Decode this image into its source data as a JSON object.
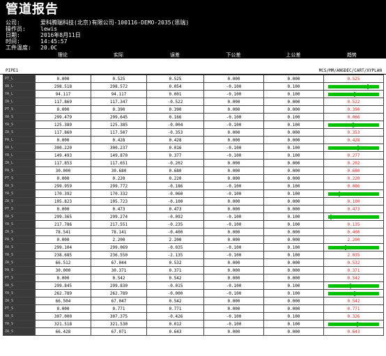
{
  "header": {
    "title": "管道报告"
  },
  "info": [
    {
      "key": "公司:",
      "value": "爱科腾瑞科技(北京)有限公司-100116-DEMO-2035(思瑞)"
    },
    {
      "key": "操作员:",
      "value": "lewis"
    },
    {
      "key": "日期:",
      "value": "2016年8月11日"
    },
    {
      "key": "时间:",
      "value": "14:45:57"
    },
    {
      "key": "工件温度:",
      "value": "20.0C"
    }
  ],
  "columns": [
    "",
    "理论",
    "实际",
    "误差",
    "下公差",
    "上公差",
    "趋势"
  ],
  "pipe": {
    "name": "PIPE1",
    "mode": "MCS/MM/ANGDEC/CART/XYPLAN"
  },
  "rows": [
    {
      "label": "PT_L",
      "nominal": "0.000",
      "actual": "0.525",
      "dev": "0.525",
      "lower": "0.000",
      "upper": "0.000",
      "trend": "0.525",
      "type": "red"
    },
    {
      "label": "XA_L",
      "nominal": "298.518",
      "actual": "298.572",
      "dev": "0.054",
      "lower": "-0.100",
      "upper": "0.100",
      "trend": "",
      "type": "bar"
    },
    {
      "label": "YA_L",
      "nominal": "94.117",
      "actual": "94.117",
      "dev": "0.001",
      "lower": "-0.100",
      "upper": "0.100",
      "trend": "",
      "type": "bar"
    },
    {
      "label": "ZA_L",
      "nominal": "117.869",
      "actual": "117.347",
      "dev": "-0.522",
      "lower": "0.000",
      "upper": "0.000",
      "trend": "0.522",
      "type": "red"
    },
    {
      "label": "PT_S",
      "nominal": "0.000",
      "actual": "0.390",
      "dev": "0.390",
      "lower": "0.000",
      "upper": "0.000",
      "trend": "0.390",
      "type": "red"
    },
    {
      "label": "XA_S",
      "nominal": "299.479",
      "actual": "299.645",
      "dev": "0.166",
      "lower": "-0.100",
      "upper": "0.100",
      "trend": "0.066",
      "type": "red"
    },
    {
      "label": "YA_S",
      "nominal": "125.389",
      "actual": "125.385",
      "dev": "-0.004",
      "lower": "-0.100",
      "upper": "0.100",
      "trend": "",
      "type": "bar"
    },
    {
      "label": "ZA_S",
      "nominal": "117.860",
      "actual": "117.507",
      "dev": "-0.353",
      "lower": "0.000",
      "upper": "0.000",
      "trend": "0.353",
      "type": "red"
    },
    {
      "label": "PA_L",
      "nominal": "0.000",
      "actual": "0.428",
      "dev": "0.428",
      "lower": "0.000",
      "upper": "0.000",
      "trend": "0.428",
      "type": "red"
    },
    {
      "label": "XA_L",
      "nominal": "300.220",
      "actual": "300.237",
      "dev": "0.016",
      "lower": "-0.100",
      "upper": "0.100",
      "trend": "",
      "type": "bar"
    },
    {
      "label": "YA_L",
      "nominal": "149.493",
      "actual": "149.870",
      "dev": "0.377",
      "lower": "-0.100",
      "upper": "0.100",
      "trend": "0.277",
      "type": "red"
    },
    {
      "label": "ZA_L",
      "nominal": "117.853",
      "actual": "117.651",
      "dev": "-0.202",
      "lower": "0.000",
      "upper": "0.000",
      "trend": "0.202",
      "type": "red"
    },
    {
      "label": "PA_S",
      "nominal": "30.000",
      "actual": "30.680",
      "dev": "0.680",
      "lower": "0.000",
      "upper": "0.000",
      "trend": "0.680",
      "type": "red"
    },
    {
      "label": "PT_S",
      "nominal": "0.000",
      "actual": "0.220",
      "dev": "0.220",
      "lower": "0.000",
      "upper": "0.000",
      "trend": "0.220",
      "type": "red"
    },
    {
      "label": "XA_S",
      "nominal": "299.959",
      "actual": "299.772",
      "dev": "-0.186",
      "lower": "-0.100",
      "upper": "0.100",
      "trend": "0.086",
      "type": "red"
    },
    {
      "label": "YA_S",
      "nominal": "170.392",
      "actual": "170.332",
      "dev": "-0.060",
      "lower": "-0.100",
      "upper": "0.100",
      "trend": "",
      "type": "bar"
    },
    {
      "label": "ZA_S",
      "nominal": "105.823",
      "actual": "105.723",
      "dev": "-0.100",
      "lower": "0.000",
      "upper": "0.000",
      "trend": "0.100",
      "type": "red"
    },
    {
      "label": "PT_S",
      "nominal": "0.000",
      "actual": "0.473",
      "dev": "0.473",
      "lower": "0.000",
      "upper": "0.000",
      "trend": "0.473",
      "type": "red"
    },
    {
      "label": "XA_S",
      "nominal": "299.365",
      "actual": "299.274",
      "dev": "-0.092",
      "lower": "-0.100",
      "upper": "0.100",
      "trend": "",
      "type": "bar"
    },
    {
      "label": "YA_S",
      "nominal": "217.786",
      "actual": "217.551",
      "dev": "-0.235",
      "lower": "-0.100",
      "upper": "0.100",
      "trend": "0.135",
      "type": "red"
    },
    {
      "label": "ZA_S",
      "nominal": "78.541",
      "actual": "78.141",
      "dev": "-0.400",
      "lower": "0.000",
      "upper": "0.000",
      "trend": "0.400",
      "type": "red"
    },
    {
      "label": "PA_S",
      "nominal": "0.000",
      "actual": "2.200",
      "dev": "2.200",
      "lower": "0.000",
      "upper": "0.000",
      "trend": "2.200",
      "type": "red"
    },
    {
      "label": "XA_S",
      "nominal": "299.104",
      "actual": "299.069",
      "dev": "-0.035",
      "lower": "-0.100",
      "upper": "0.100",
      "trend": "",
      "type": "bar"
    },
    {
      "label": "YA_S",
      "nominal": "238.685",
      "actual": "236.550",
      "dev": "-2.135",
      "lower": "-0.100",
      "upper": "0.100",
      "trend": "2.035",
      "type": "red"
    },
    {
      "label": "ZA_S",
      "nominal": "66.512",
      "actual": "67.044",
      "dev": "0.532",
      "lower": "0.000",
      "upper": "0.000",
      "trend": "0.532",
      "type": "red"
    },
    {
      "label": "PA_S",
      "nominal": "30.000",
      "actual": "30.371",
      "dev": "0.371",
      "lower": "0.000",
      "upper": "0.000",
      "trend": "0.371",
      "type": "red"
    },
    {
      "label": "PT_S",
      "nominal": "0.000",
      "actual": "0.542",
      "dev": "0.542",
      "lower": "0.000",
      "upper": "0.000",
      "trend": "0.542",
      "type": "red"
    },
    {
      "label": "XA_S",
      "nominal": "299.845",
      "actual": "299.830",
      "dev": "-0.015",
      "lower": "-0.100",
      "upper": "0.100",
      "trend": "",
      "type": "bar"
    },
    {
      "label": "YA_S",
      "nominal": "262.789",
      "actual": "262.789",
      "dev": "-0.000",
      "lower": "-0.100",
      "upper": "0.100",
      "trend": "",
      "type": "bar"
    },
    {
      "label": "ZA_S",
      "nominal": "66.504",
      "actual": "67.047",
      "dev": "0.542",
      "lower": "0.000",
      "upper": "0.000",
      "trend": "0.542",
      "type": "red"
    },
    {
      "label": "PT_S",
      "nominal": "0.000",
      "actual": "0.771",
      "dev": "0.771",
      "lower": "0.000",
      "upper": "0.000",
      "trend": "0.771",
      "type": "red"
    },
    {
      "label": "XA_S",
      "nominal": "307.000",
      "actual": "307.375",
      "dev": "-0.426",
      "lower": "-0.100",
      "upper": "0.100",
      "trend": "0.326",
      "type": "red"
    },
    {
      "label": "YA_S",
      "nominal": "321.518",
      "actual": "321.530",
      "dev": "0.012",
      "lower": "-0.100",
      "upper": "0.100",
      "trend": "",
      "type": "bar"
    },
    {
      "label": "ZA_S",
      "nominal": "66.428",
      "actual": "67.071",
      "dev": "0.643",
      "lower": "0.000",
      "upper": "0.000",
      "trend": "0.643",
      "type": "red"
    }
  ],
  "colors": {
    "ok": "#00c000",
    "bad": "#e02020"
  }
}
